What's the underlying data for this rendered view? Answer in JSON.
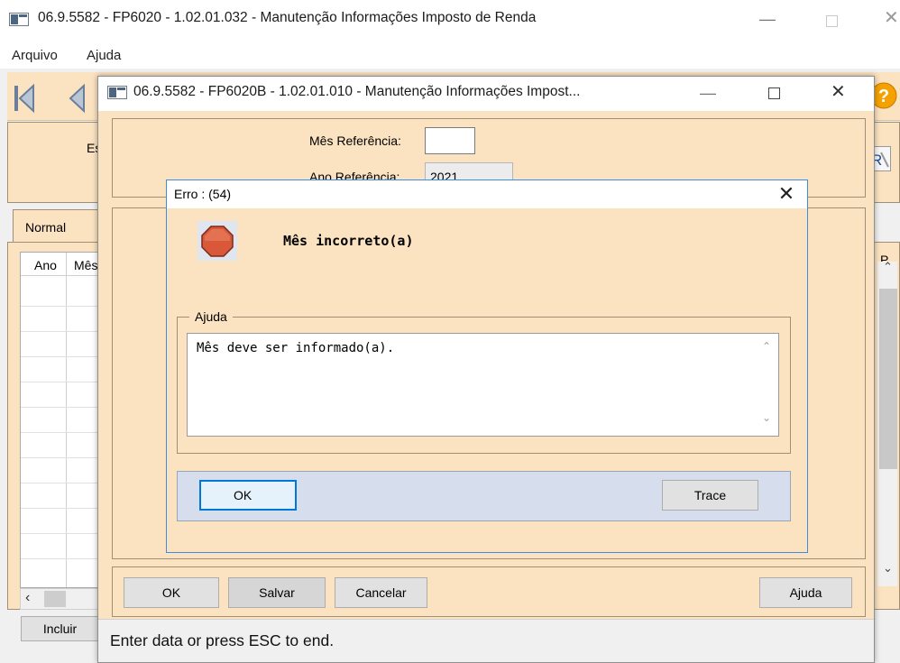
{
  "main_window": {
    "title": "06.9.5582 - FP6020 - 1.02.01.032 - Manutenção Informações Imposto de Renda",
    "menu": [
      "Arquivo",
      "Ajuda"
    ],
    "filter_label_partial": "Es",
    "tab_label": "Normal",
    "grid_columns": [
      "Ano",
      "Mês"
    ],
    "right_partial_header": "P",
    "incluir_label": "Incluir"
  },
  "secondary_dialog": {
    "title": "06.9.5582 - FP6020B - 1.02.01.010 - Manutenção Informações Impost...",
    "mes_referencia_label": "Mês Referência:",
    "mes_referencia_value": "",
    "ano_referencia_label": "Ano Referência:",
    "ano_referencia_value": "2021",
    "buttons": {
      "ok": "OK",
      "salvar": "Salvar",
      "cancelar": "Cancelar",
      "ajuda": "Ajuda"
    },
    "status_text": "Enter data or press ESC to end."
  },
  "error_dialog": {
    "title": "Erro : (54)",
    "message": "Mês incorreto(a)",
    "help_legend": "Ajuda",
    "help_text": "Mês deve ser informado(a).",
    "ok_label": "OK",
    "trace_label": "Trace"
  },
  "colors": {
    "panel_bg": "#fbe2c0",
    "focus_blue": "#0078d7",
    "stop_red": "#d9583a",
    "button_bar_blue": "#d6dded"
  }
}
